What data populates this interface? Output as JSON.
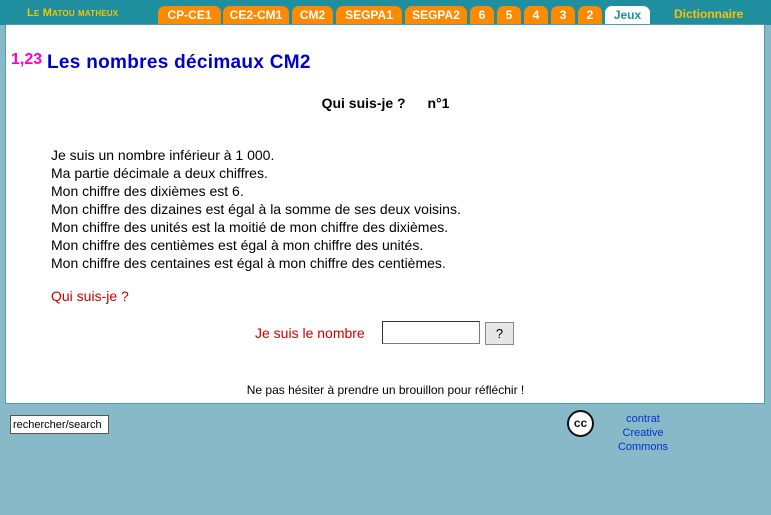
{
  "nav": {
    "brand": "Le Matou matheux",
    "tabs": [
      "CP-CE1",
      "CE2-CM1",
      "CM2",
      "SEGPA1",
      "SEGPA2",
      "6",
      "5",
      "4",
      "3",
      "2",
      "Jeux"
    ],
    "dictionary": "Dictionnaire"
  },
  "header": {
    "logo_number": "1,23",
    "title": "Les nombres décimaux CM2",
    "subtitle": "Qui suis-je ?",
    "exercise_number": "n°1"
  },
  "clues": [
    "Je suis un nombre inférieur à 1 000.",
    "Ma partie décimale a deux chiffres.",
    "Mon chiffre des dixièmes est 6.",
    "Mon chiffre des dizaines est égal à la somme de ses deux voisins.",
    "Mon chiffre des unités est la moitié de mon chiffre des dixièmes.",
    "Mon chiffre des centièmes est égal à mon chiffre des unités.",
    "Mon chiffre des centaines est égal à mon chiffre des centièmes."
  ],
  "question": "Qui suis-je ?",
  "answer": {
    "label": "Je suis le nombre",
    "value": "",
    "button": "?"
  },
  "hint": "Ne pas hésiter à prendre un brouillon pour réfléchir !",
  "search": {
    "value": "rechercher/search"
  },
  "license": {
    "icon_label": "cc",
    "line1": "contrat",
    "line2": "Creative Commons"
  },
  "colors": {
    "nav_bg": "#1f8fa0",
    "tab": "#ff8a00",
    "brand": "#f6c400",
    "title": "#0000cc",
    "accent_red": "#cc0000",
    "page_bg": "#87b9c9"
  }
}
